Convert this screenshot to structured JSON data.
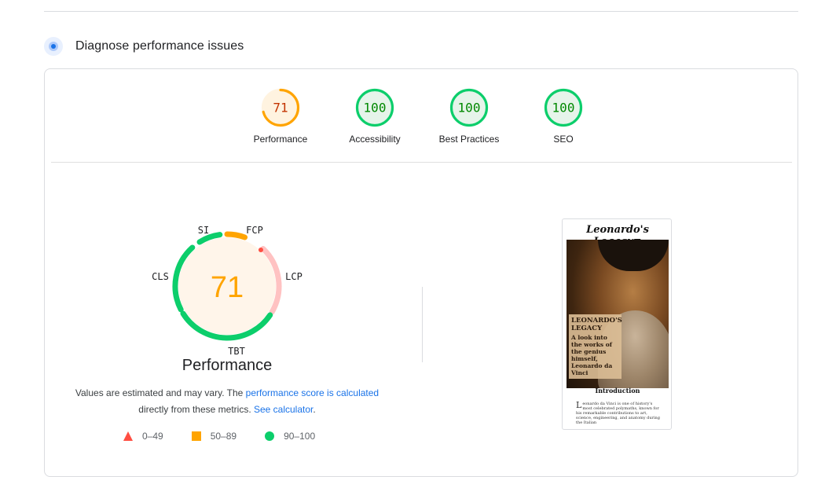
{
  "section": {
    "title": "Diagnose performance issues",
    "icon": "performance-icon"
  },
  "categories": [
    {
      "label": "Performance",
      "score": "71",
      "value": 71,
      "color": "#ffa400",
      "bg": "#fff3e0",
      "text": "#c33300"
    },
    {
      "label": "Accessibility",
      "score": "100",
      "value": 100,
      "color": "#0cce6b",
      "bg": "#e6f4ea",
      "text": "#008800"
    },
    {
      "label": "Best Practices",
      "score": "100",
      "value": 100,
      "color": "#0cce6b",
      "bg": "#e6f4ea",
      "text": "#008800"
    },
    {
      "label": "SEO",
      "score": "100",
      "value": 100,
      "color": "#0cce6b",
      "bg": "#e6f4ea",
      "text": "#008800"
    }
  ],
  "performance": {
    "score": "71",
    "label": "Performance",
    "metrics": [
      {
        "abbr": "SI",
        "status": "pass",
        "color": "#0cce6b"
      },
      {
        "abbr": "FCP",
        "status": "average",
        "color": "#ffa400"
      },
      {
        "abbr": "LCP",
        "status": "fail",
        "color": "#ff4e42"
      },
      {
        "abbr": "TBT",
        "status": "pass",
        "color": "#0cce6b"
      },
      {
        "abbr": "CLS",
        "status": "pass",
        "color": "#0cce6b"
      }
    ],
    "description_part1": "Values are estimated and may vary. The ",
    "link1": "performance score is calculated",
    "description_part2": "directly from these metrics. ",
    "link2": "See calculator",
    "description_end": "."
  },
  "legend": [
    {
      "shape": "triangle",
      "range": "0–49",
      "color": "#ff4e42"
    },
    {
      "shape": "square",
      "range": "50–89",
      "color": "#ffa400"
    },
    {
      "shape": "circle",
      "range": "90–100",
      "color": "#0cce6b"
    }
  ],
  "screenshot": {
    "brand": "Leonardo's Legacy≡",
    "overlay_title": "LEONARDO'S LEGACY",
    "overlay_sub": "A look into the works of the genius himself, Leonardo da Vinci",
    "intro": "Introduction",
    "body_drop": "L",
    "body": "eonardo da Vinci is one of history's most celebrated polymaths, known for his remarkable contributions to art, science, engineering, and anatomy during the Italian"
  }
}
